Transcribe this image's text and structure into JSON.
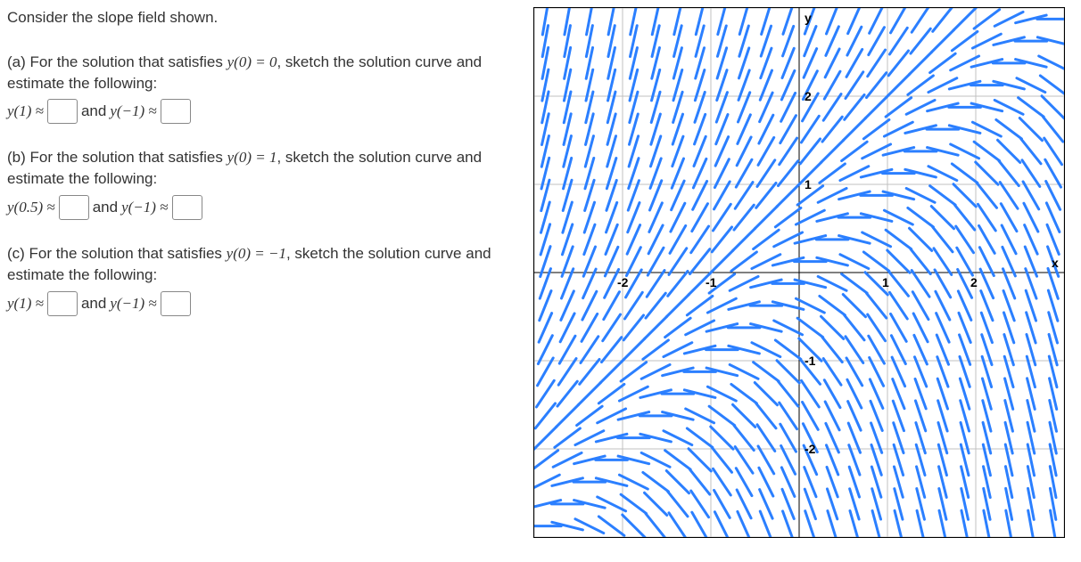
{
  "intro": "Consider the slope field shown.",
  "parts": {
    "a": {
      "prompt_prefix": "(a) For the solution that satisfies ",
      "condition": "y(0) = 0",
      "prompt_suffix": ", sketch the solution curve and estimate the following:",
      "ans1_label": "y(1) ≈",
      "mid": " and ",
      "ans2_label": "y(−1) ≈"
    },
    "b": {
      "prompt_prefix": "(b) For the solution that satisfies ",
      "condition": "y(0) = 1",
      "prompt_suffix": ", sketch the solution curve and estimate the following:",
      "ans1_label": "y(0.5) ≈",
      "mid": " and ",
      "ans2_label": "y(−1) ≈"
    },
    "c": {
      "prompt_prefix": "(c) For the solution that satisfies ",
      "condition": "y(0) = −1",
      "prompt_suffix": ", sketch the solution curve and estimate the following:",
      "ans1_label": "y(1) ≈",
      "mid": " and ",
      "ans2_label": "y(−1) ≈"
    }
  },
  "chart_data": {
    "type": "slope_field",
    "xrange": [
      -3,
      3
    ],
    "yrange": [
      -3,
      3
    ],
    "x_axis_label": "x",
    "y_axis_label": "y",
    "xticks": [
      -2,
      -1,
      1,
      2
    ],
    "yticks": [
      -2,
      -1,
      1,
      2
    ],
    "step": 0.25,
    "segment_length": 0.18,
    "slope_formula": "y - x",
    "segment_color": "#2b7fff"
  }
}
